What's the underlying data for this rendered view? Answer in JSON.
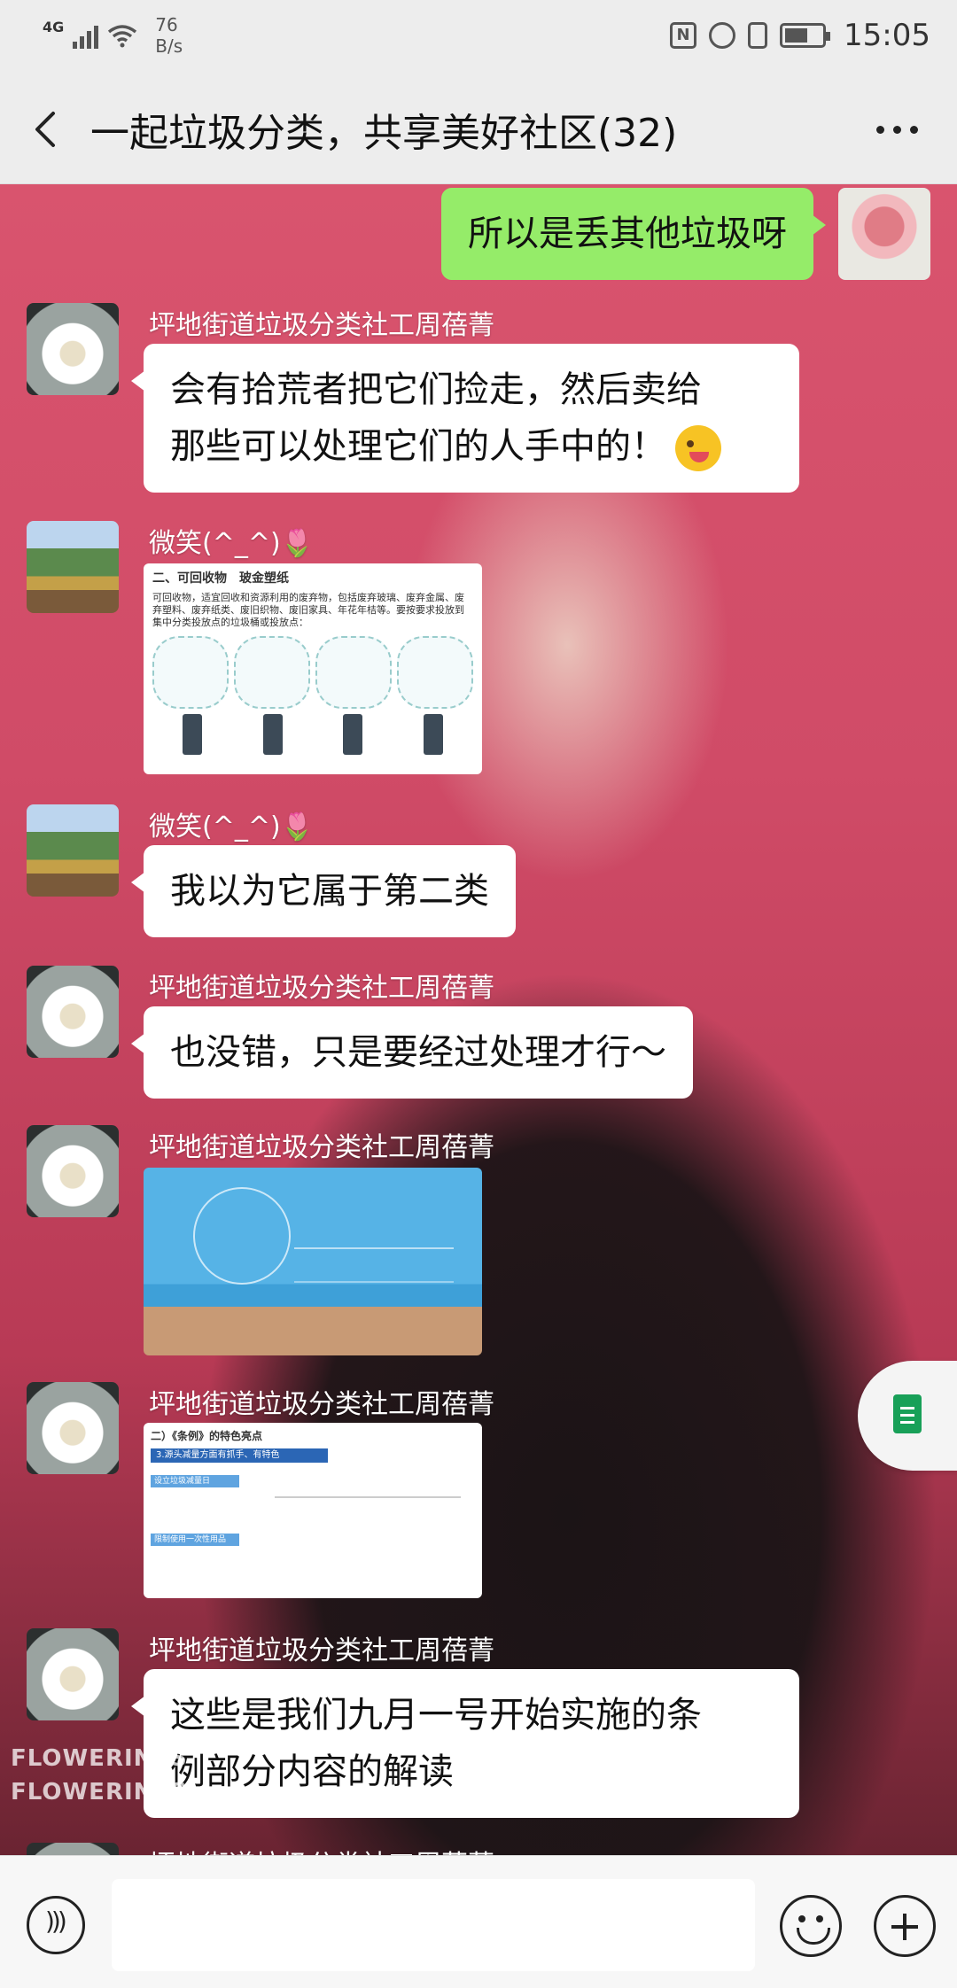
{
  "status_bar": {
    "network": "4G",
    "speed_value": "76",
    "speed_unit": "B/s",
    "nfc_label": "N",
    "battery_level": 0.55,
    "time": "15:05"
  },
  "header": {
    "title": "一起垃圾分类，共享美好社区(32)",
    "back_icon": "back-arrow-icon",
    "more_icon": "more-dots-icon"
  },
  "messages": [
    {
      "type": "text",
      "self": true,
      "text": "所以是丢其他垃圾呀"
    },
    {
      "type": "text",
      "sender": "坪地街道垃圾分类社工周蓓菁",
      "text_line1": "会有拾荒者把它们捡走，然后卖给",
      "text_line2": "那些可以处理它们的人手中的！",
      "emoji": "winking-face-tongue-emoji"
    },
    {
      "type": "image",
      "sender": "微笑(^_^)🌷",
      "caption_head": "二、可回收物",
      "caption_title": "玻金塑纸",
      "caption_body": "可回收物，适宜回收和资源利用的废弃物，包括废弃玻璃、废弃金属、废弃塑料、废弃纸类、废旧织物、废旧家具、年花年桔等。要按要求投放到集中分类投放点的垃圾桶或投放点："
    },
    {
      "type": "text",
      "sender": "微笑(^_^)🌷",
      "text": "我以为它属于第二类"
    },
    {
      "type": "text",
      "sender": "坪地街道垃圾分类社工周蓓菁",
      "text": "也没错，只是要经过处理才行～"
    },
    {
      "type": "image",
      "sender": "坪地街道垃圾分类社工周蓓菁"
    },
    {
      "type": "image",
      "sender": "坪地街道垃圾分类社工周蓓菁",
      "caption_head": "二）《条例》的特色亮点",
      "caption_bar": "3.源头减量方面有抓手、有特色",
      "caption_tag1": "设立垃圾减量日",
      "caption_tag2": "限制使用一次性用品"
    },
    {
      "type": "text",
      "sender": "坪地街道垃圾分类社工周蓓菁",
      "text_line1": "这些是我们九月一号开始实施的条",
      "text_line2": "例部分内容的解读"
    },
    {
      "type": "text",
      "sender": "坪地街道垃圾分类社工周蓓菁",
      "partial": true
    }
  ],
  "watermark": {
    "line1": "FLOWERINES",
    "line2": "FLOWERINES"
  },
  "input_bar": {
    "voice_icon": "voice-icon",
    "placeholder": "",
    "emoji_icon": "smile-icon",
    "plus_icon": "plus-icon"
  },
  "side_button": {
    "icon": "document-icon",
    "color": "#18a058"
  },
  "colors": {
    "self_bubble": "#95ec69",
    "other_bubble": "#ffffff",
    "chrome": "#ededed"
  }
}
